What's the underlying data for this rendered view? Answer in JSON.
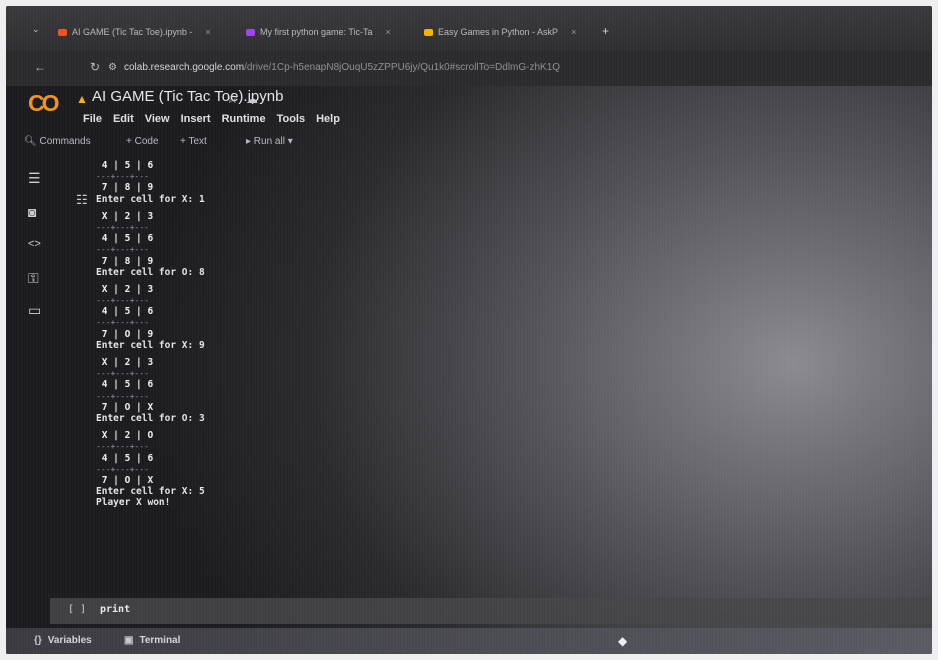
{
  "browser": {
    "tabs": [
      {
        "label": "AI GAME (Tic Tac Toe).ipynb -",
        "favicon_color": "#f4511e"
      },
      {
        "label": "My first python game: Tic-Ta",
        "favicon_color": "#a142f4"
      },
      {
        "label": "Easy Games in Python - AskP",
        "favicon_color": "#f4b400"
      }
    ],
    "tab_close": "×",
    "new_tab": "+",
    "url_domain": "colab.research.google.com",
    "url_rest": "/drive/1Cp-h5enapN8jOuqU5zZPPU6jy/Qu1k0#scrollTo=DdlmG-zhK1Q"
  },
  "colab": {
    "logo": "CO",
    "notebook_title": "AI GAME (Tic Tac Toe).ipynb",
    "menu": [
      "File",
      "Edit",
      "View",
      "Insert",
      "Runtime",
      "Tools",
      "Help"
    ],
    "toolbar": {
      "commands": "Commands",
      "add_code": "+ Code",
      "add_text": "+ Text",
      "run_all": "▸ Run all ▾"
    }
  },
  "output_lines": [
    {
      "text": " 4 | 5 | 6",
      "kind": "grid"
    },
    {
      "text": "---+---+---",
      "kind": "div"
    },
    {
      "text": " 7 | 8 | 9",
      "kind": "grid"
    },
    {
      "text": "Enter cell for X: 1",
      "kind": "text"
    },
    {
      "text": "",
      "kind": "blank"
    },
    {
      "text": " X | 2 | 3",
      "kind": "grid"
    },
    {
      "text": "---+---+---",
      "kind": "div"
    },
    {
      "text": " 4 | 5 | 6",
      "kind": "grid"
    },
    {
      "text": "---+---+---",
      "kind": "div"
    },
    {
      "text": " 7 | 8 | 9",
      "kind": "grid"
    },
    {
      "text": "Enter cell for O: 8",
      "kind": "text"
    },
    {
      "text": "",
      "kind": "blank"
    },
    {
      "text": " X | 2 | 3",
      "kind": "grid"
    },
    {
      "text": "---+---+---",
      "kind": "div"
    },
    {
      "text": " 4 | 5 | 6",
      "kind": "grid"
    },
    {
      "text": "---+---+---",
      "kind": "div"
    },
    {
      "text": " 7 | O | 9",
      "kind": "grid"
    },
    {
      "text": "Enter cell for X: 9",
      "kind": "text"
    },
    {
      "text": "",
      "kind": "blank"
    },
    {
      "text": " X | 2 | 3",
      "kind": "grid"
    },
    {
      "text": "---+---+---",
      "kind": "div"
    },
    {
      "text": " 4 | 5 | 6",
      "kind": "grid"
    },
    {
      "text": "---+---+---",
      "kind": "div"
    },
    {
      "text": " 7 | O | X",
      "kind": "grid"
    },
    {
      "text": "Enter cell for O: 3",
      "kind": "text"
    },
    {
      "text": "",
      "kind": "blank"
    },
    {
      "text": " X | 2 | O",
      "kind": "grid"
    },
    {
      "text": "---+---+---",
      "kind": "div"
    },
    {
      "text": " 4 | 5 | 6",
      "kind": "grid"
    },
    {
      "text": "---+---+---",
      "kind": "div"
    },
    {
      "text": " 7 | O | X",
      "kind": "grid"
    },
    {
      "text": "Enter cell for X: 5",
      "kind": "text"
    },
    {
      "text": "Player X won!",
      "kind": "text"
    }
  ],
  "code_cell": {
    "run_marker": "[ ]",
    "code": "print"
  },
  "statusbar": {
    "variables": "Variables",
    "terminal": "Terminal"
  },
  "icons": {
    "toc": "list-icon",
    "find": "find-icon",
    "code_snippets": "code-icon",
    "secrets": "key-icon",
    "files": "folder-icon"
  }
}
